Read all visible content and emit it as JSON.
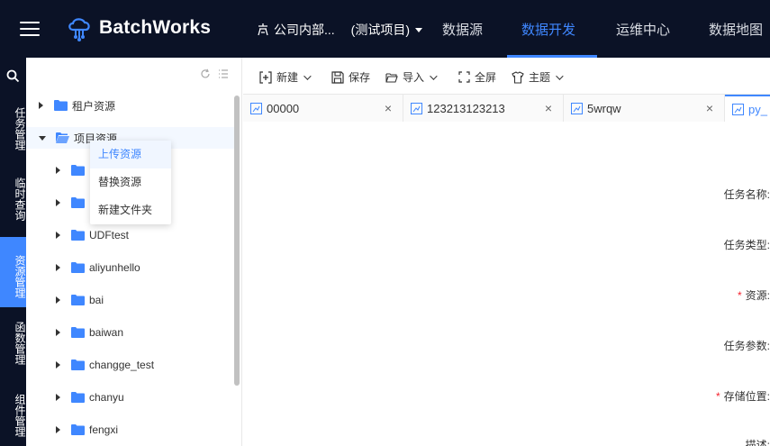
{
  "header": {
    "brand": "BatchWorks",
    "tenant_name": "公司内部...",
    "project_name": "(测试项目)",
    "nav": [
      "数据源",
      "数据开发",
      "运维中心",
      "数据地图"
    ],
    "active_nav": "数据开发"
  },
  "left_nav": {
    "items": [
      "任务管理",
      "临时查询",
      "资源管理",
      "函数管理",
      "组件管理"
    ],
    "active": "资源管理"
  },
  "tree": {
    "root_items": [
      "租户资源",
      "项目资源"
    ],
    "children": [
      "UDFtest",
      "aliyunhello",
      "bai",
      "baiwan",
      "changge_test",
      "chanyu",
      "fengxi"
    ]
  },
  "context_menu": {
    "items": [
      "上传资源",
      "替换资源",
      "新建文件夹"
    ]
  },
  "toolbar": {
    "new": "新建",
    "save": "保存",
    "import": "导入",
    "fullscreen": "全屏",
    "theme": "主题"
  },
  "tabs": [
    "00000",
    "123213123213",
    "5wrqw",
    "py_"
  ],
  "form": {
    "task_name": "任务名称:",
    "task_type": "任务类型:",
    "resource": "资源:",
    "task_params": "任务参数:",
    "storage": "存储位置:",
    "description": "描述:"
  },
  "colors": {
    "header_bg": "#0b1226",
    "accent": "#3f87ff",
    "folder": "#3f87ff"
  }
}
